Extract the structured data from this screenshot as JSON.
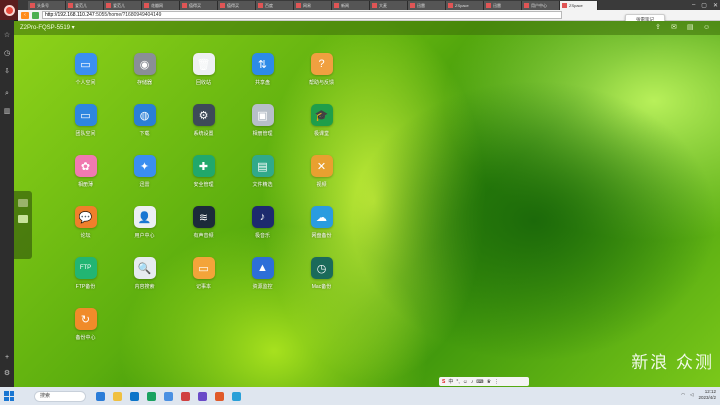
{
  "browser": {
    "tabs": [
      {
        "label": "头条号"
      },
      {
        "label": "爱范儿"
      },
      {
        "label": "爱范儿"
      },
      {
        "label": "花瓣网"
      },
      {
        "label": "值得买"
      },
      {
        "label": "值得买"
      },
      {
        "label": "百度"
      },
      {
        "label": "网易"
      },
      {
        "label": "新闻"
      },
      {
        "label": "大麦"
      },
      {
        "label": "迅雷"
      },
      {
        "label": "ZSpace"
      },
      {
        "label": "迅雷"
      },
      {
        "label": "用户中心"
      },
      {
        "label": "ZSpace"
      }
    ],
    "address": {
      "host": "http://192.168.110.247",
      "path": ":5055/home/?1680949404149"
    },
    "toast": "张雷笔记"
  },
  "page": {
    "device_name": "Z2Pro-FQSP-5519 ▾"
  },
  "apps": [
    {
      "label": "个人空间",
      "icon": "folder-icon",
      "color": "#3b8ff0",
      "glyph": "▭"
    },
    {
      "label": "存储器",
      "icon": "disk-icon",
      "color": "#8a8f96",
      "glyph": "◉"
    },
    {
      "label": "回收站",
      "icon": "trash-icon",
      "color": "#eef0f2",
      "glyph": "🗑"
    },
    {
      "label": "共享盘",
      "icon": "share-icon",
      "color": "#2d8be8",
      "glyph": "⇅"
    },
    {
      "label": "帮助与反馈",
      "icon": "help-icon",
      "color": "#f0a040",
      "glyph": "?"
    },
    {
      "label": "团队空间",
      "icon": "team-folder-icon",
      "color": "#2e86e0",
      "glyph": "▭"
    },
    {
      "label": "下载",
      "icon": "download-globe-icon",
      "color": "#2a7fd6",
      "glyph": "◍"
    },
    {
      "label": "系统设置",
      "icon": "settings-icon",
      "color": "#3d4a58",
      "glyph": "⚙"
    },
    {
      "label": "相册管理",
      "icon": "photo-manager-icon",
      "color": "#b7bfc8",
      "glyph": "▣"
    },
    {
      "label": "极课堂",
      "icon": "graduation-cap-icon",
      "color": "#1f9e4a",
      "glyph": "🎓"
    },
    {
      "label": "相册薄",
      "icon": "album-icon",
      "color": "#f07ab0",
      "glyph": "✿"
    },
    {
      "label": "迅雷",
      "icon": "thunder-icon",
      "color": "#3a8ef0",
      "glyph": "✦"
    },
    {
      "label": "安全管理",
      "icon": "security-icon",
      "color": "#21a86b",
      "glyph": "✚"
    },
    {
      "label": "文件精选",
      "icon": "files-icon",
      "color": "#31a98a",
      "glyph": "▤"
    },
    {
      "label": "视频",
      "icon": "video-icon",
      "color": "#e8a030",
      "glyph": "✕"
    },
    {
      "label": "论坛",
      "icon": "forum-chat-icon",
      "color": "#f07f2b",
      "glyph": "💬"
    },
    {
      "label": "用户中心",
      "icon": "user-center-icon",
      "color": "#eceff2",
      "glyph": "👤"
    },
    {
      "label": "有声音频",
      "icon": "audio-icon",
      "color": "#1c2a3a",
      "glyph": "≋"
    },
    {
      "label": "极音乐",
      "icon": "music-icon",
      "color": "#1d2a6e",
      "glyph": "♪"
    },
    {
      "label": "网盘备份",
      "icon": "cloud-backup-icon",
      "color": "#2a9ce0",
      "glyph": "☁"
    },
    {
      "label": "FTP备份",
      "icon": "ftp-icon",
      "color": "#22b573",
      "glyph": "FTP"
    },
    {
      "label": "内容搜索",
      "icon": "search-app-icon",
      "color": "#e6ebf0",
      "glyph": "🔍"
    },
    {
      "label": "记事本",
      "icon": "notepad-icon",
      "color": "#f3a43a",
      "glyph": "▭"
    },
    {
      "label": "资源监控",
      "icon": "monitor-chart-icon",
      "color": "#2d6fd8",
      "glyph": "▲"
    },
    {
      "label": "Mac备份",
      "icon": "mac-backup-icon",
      "color": "#1b6a5a",
      "glyph": "◷"
    },
    {
      "label": "备份中心",
      "icon": "backup-center-icon",
      "color": "#f08b2a",
      "glyph": "↻"
    }
  ],
  "taskbar": {
    "search": "搜索",
    "time": "12:12",
    "date": "2023/4/2"
  },
  "watermark": "新浪 众测"
}
